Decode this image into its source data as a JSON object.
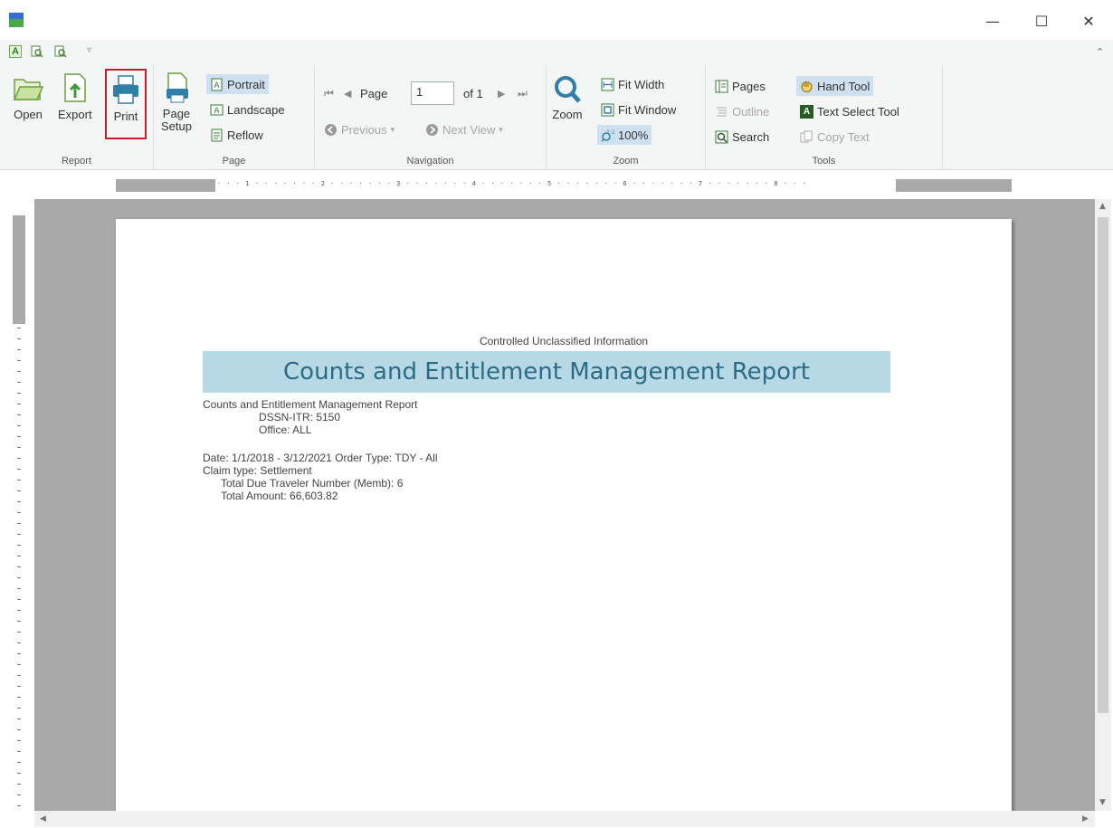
{
  "window": {
    "minimize": "—",
    "maximize": "☐",
    "close": "✕"
  },
  "qat": {
    "caret": "▿",
    "collapse": "⌃"
  },
  "ribbon": {
    "report": {
      "label": "Report",
      "open": "Open",
      "export": "Export",
      "print": "Print"
    },
    "page": {
      "label": "Page",
      "setup_line1": "Page",
      "setup_line2": "Setup",
      "portrait": "Portrait",
      "landscape": "Landscape",
      "reflow": "Reflow"
    },
    "navigation": {
      "label": "Navigation",
      "page_text": "Page",
      "page_value": "1",
      "of_text": "of 1",
      "previous": "Previous",
      "next_view": "Next View"
    },
    "zoom": {
      "label": "Zoom",
      "zoom": "Zoom",
      "fit_width": "Fit Width",
      "fit_window": "Fit Window",
      "zoom_level": "100%"
    },
    "tools": {
      "label": "Tools",
      "pages": "Pages",
      "outline": "Outline",
      "search": "Search",
      "hand_tool": "Hand Tool",
      "text_select_tool": "Text Select Tool",
      "copy_text": "Copy Text"
    }
  },
  "ruler": {
    "top_text": "· · · 1 · · · · · · · 2 · · · · · · · 3 · · · · · · · 4 · · · · · · · 5 · · · · · · · 6 · · · · · · · 7 · · · · · · · 8 · · ·"
  },
  "document": {
    "cui": "Controlled Unclassified Information",
    "title": "Counts and Entitlement Management Report",
    "subtitle": "Counts and Entitlement Management Report",
    "dssn": "DSSN-ITR: 5150",
    "office": "Office: ALL",
    "date_line": "Date: 1/1/2018 - 3/12/2021   Order Type: TDY - All",
    "claim_type": "Claim type: Settlement",
    "total_due": "Total Due Traveler Number (Memb): 6",
    "total_amount": "Total Amount: 66,603.82"
  },
  "colors": {
    "title_band": "#b7d9e6",
    "title_text": "#2d6b84",
    "print_highlight": "#c0202a",
    "active_bg": "#cfe0f0"
  }
}
